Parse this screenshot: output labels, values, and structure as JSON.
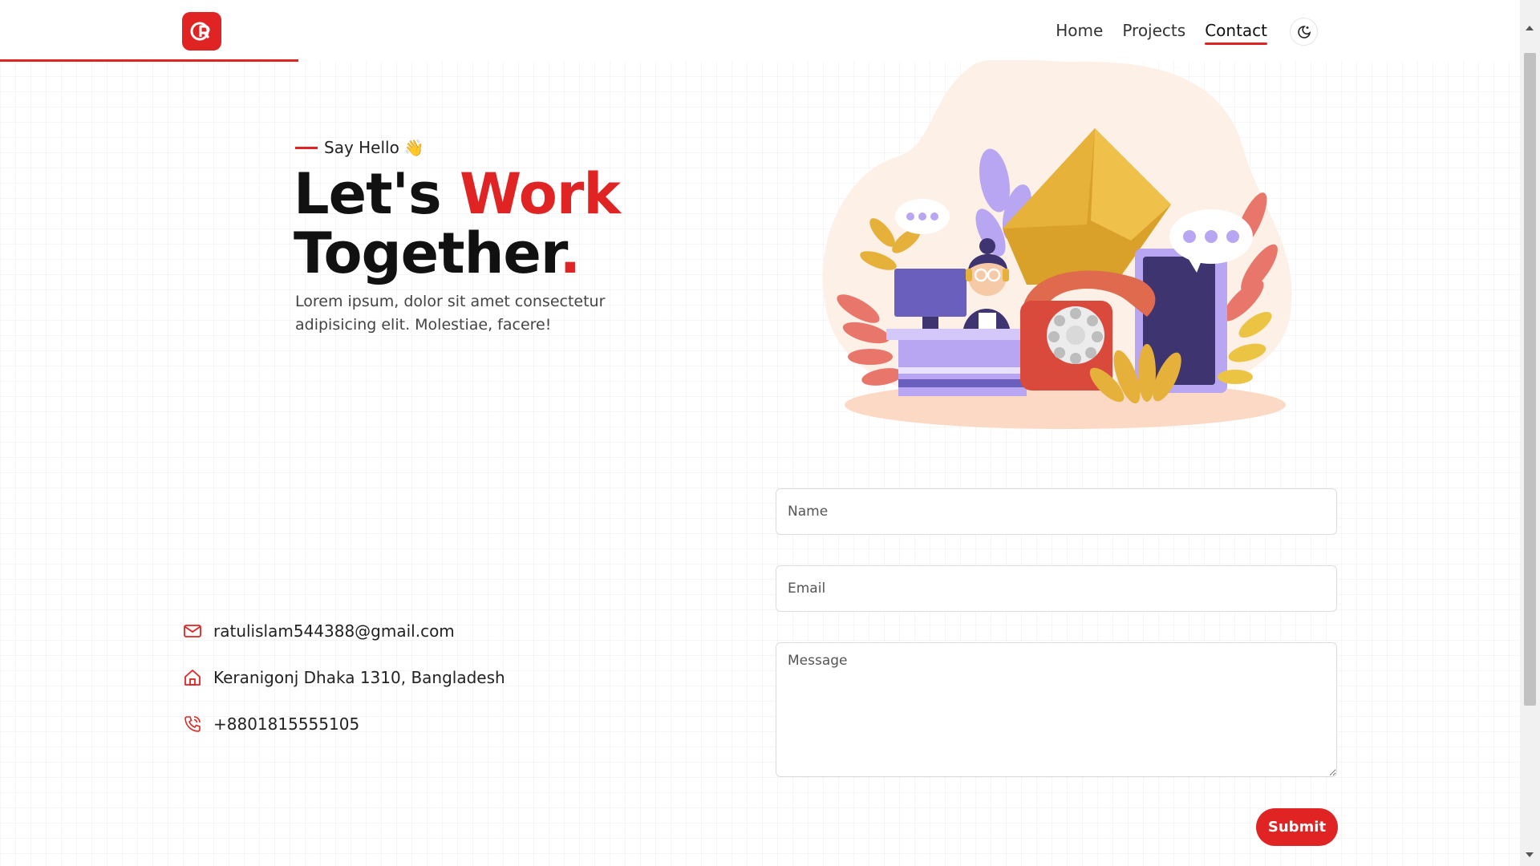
{
  "nav": {
    "logo_icon": "r-logo-icon",
    "items": [
      {
        "label": "Home",
        "active": false
      },
      {
        "label": "Projects",
        "active": false
      },
      {
        "label": "Contact",
        "active": true
      }
    ],
    "theme_toggle_icon": "moon-sun-icon"
  },
  "hero": {
    "eyebrow": "Say Hello",
    "eyebrow_emoji": "👋",
    "title_part1": "Let's ",
    "title_highlight": "Work",
    "title_line2": "Together",
    "title_dot": ".",
    "description": "Lorem ipsum, dolor sit amet consectetur adipisicing elit. Molestiae, facere!"
  },
  "contact": {
    "email": "ratulislam544388@gmail.com",
    "address": "Keranigonj Dhaka 1310, Bangladesh",
    "phone": "+8801815555105"
  },
  "form": {
    "name_placeholder": "Name",
    "email_placeholder": "Email",
    "message_placeholder": "Message",
    "submit_label": "Submit"
  },
  "colors": {
    "accent": "#e02424",
    "text": "#111111"
  }
}
